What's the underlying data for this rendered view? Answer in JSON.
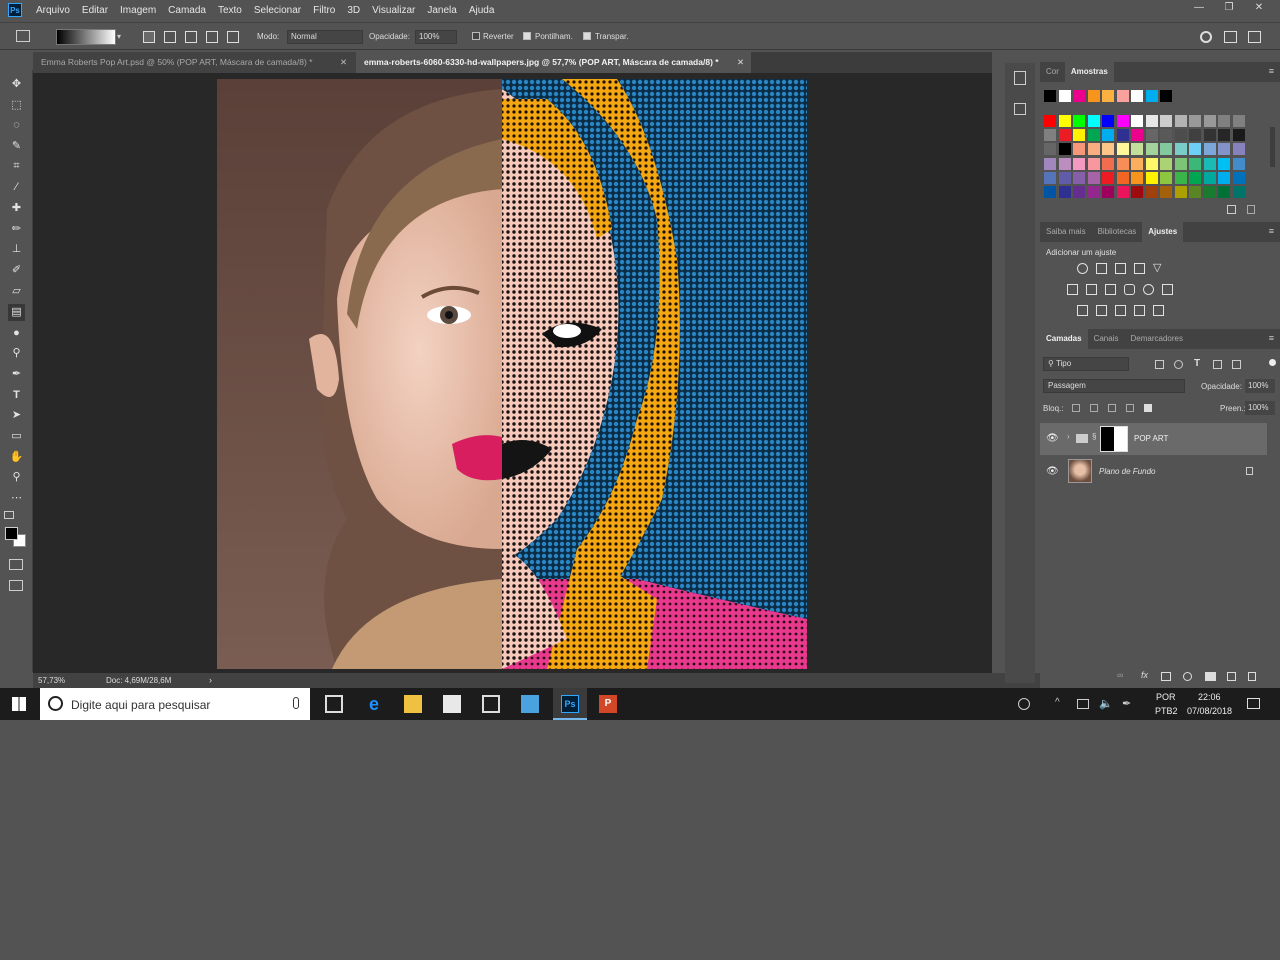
{
  "menubar": {
    "items": [
      "Arquivo",
      "Editar",
      "Imagem",
      "Camada",
      "Texto",
      "Selecionar",
      "Filtro",
      "3D",
      "Visualizar",
      "Janela",
      "Ajuda"
    ],
    "minimize": "—",
    "maximize": "❐",
    "close": "✕"
  },
  "options": {
    "mode_label": "Modo:",
    "mode_value": "Normal",
    "opacity_label": "Opacidade:",
    "opacity_value": "100%",
    "reverse": "Reverter",
    "dither": "Pontilham.",
    "transparency": "Transpar."
  },
  "tabs": [
    {
      "label": "Emma Roberts Pop Art.psd @ 50% (POP ART, Máscara de camada/8) *",
      "close": "✕"
    },
    {
      "label": "emma-roberts-6060-6330-hd-wallpapers.jpg @ 57,7% (POP ART, Máscara de camada/8) *",
      "close": "✕"
    }
  ],
  "status": {
    "zoom": "57,73%",
    "doc": "Doc: 4,69M/28,6M",
    "arrow": "›"
  },
  "color_panel": {
    "tabs": [
      "Cor",
      "Amostras"
    ],
    "swatch_colors": {
      "row0": [
        "#000000",
        "#ffffff",
        "#ec008c",
        "#f7941d",
        "#fbb040",
        "#f9a29b",
        "#ffffff",
        "#00aeef",
        "#000000"
      ],
      "row1": [
        "#ff0000",
        "#ffff00",
        "#00ff00",
        "#00ffff",
        "#0000ff",
        "#ff00ff",
        "#ffffff",
        "#e6e6e6",
        "#cccccc",
        "#b3b3b3",
        "#999999",
        "#999999",
        "#808080",
        "#808080"
      ],
      "row2": [
        "#808080",
        "#ed1c24",
        "#fff200",
        "#00a651",
        "#00aeef",
        "#2e3192",
        "#ec008c",
        "#666666",
        "#595959",
        "#4d4d4d",
        "#404040",
        "#333333",
        "#262626",
        "#1a1a1a"
      ],
      "row3": [
        "#666666",
        "#000000",
        "#f7977a",
        "#fbad82",
        "#fdc689",
        "#fff79a",
        "#c4df9b",
        "#a3d39c",
        "#82ca9d",
        "#7accc8",
        "#6dcff6",
        "#7da7d9",
        "#8393ca",
        "#8781bd"
      ],
      "row4": [
        "#a187be",
        "#bc8dbf",
        "#f49ac2",
        "#f6989d",
        "#f26c4f",
        "#f68e56",
        "#fbaf5d",
        "#fff568",
        "#acd373",
        "#7cc576",
        "#3bb878",
        "#1abbb4",
        "#00bff3",
        "#438ccb"
      ],
      "row5": [
        "#5674b9",
        "#605ca8",
        "#855fa8",
        "#a763a8",
        "#ed1c24",
        "#f26522",
        "#f7941d",
        "#fff200",
        "#8dc63f",
        "#39b54a",
        "#00a651",
        "#00a99d",
        "#00aeef",
        "#0072bc"
      ],
      "row6": [
        "#0054a6",
        "#2e3192",
        "#662d91",
        "#92278f",
        "#9e005d",
        "#ed145b",
        "#9e0b0f",
        "#a0410d",
        "#a36209",
        "#aba000",
        "#598527",
        "#197b30",
        "#007236",
        "#00746b"
      ]
    }
  },
  "adjust_panel": {
    "tabs": [
      "Saiba mais",
      "Bibliotecas",
      "Ajustes"
    ],
    "heading": "Adicionar um ajuste"
  },
  "layers_panel": {
    "tabs": [
      "Camadas",
      "Canais",
      "Demarcadores"
    ],
    "filter": "Tipo",
    "blend_mode": "Passagem",
    "opacity_label": "Opacidade:",
    "opacity_value": "100%",
    "lock_label": "Bloq.:",
    "fill_label": "Preen.:",
    "fill_value": "100%",
    "layers": [
      {
        "name": "POP ART"
      },
      {
        "name": "Plano de Fundo"
      }
    ]
  },
  "taskbar": {
    "search_placeholder": "Digite aqui para pesquisar",
    "lang": "POR",
    "layout": "PTB2",
    "time": "22:06",
    "date": "07/08/2018"
  },
  "colors": {
    "ui_bg": "#535353",
    "canvas_bg": "#282828",
    "photo_bg": "#6b5047",
    "pop_blue": "#1f6fa8",
    "pop_orange": "#f2a20c",
    "pop_pink": "#ec4f9a",
    "skin": "#f0c2b0"
  }
}
